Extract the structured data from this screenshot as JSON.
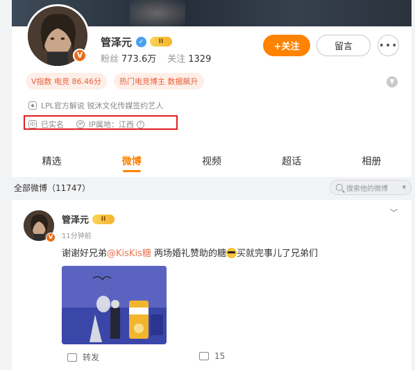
{
  "profile": {
    "name": "管泽元",
    "level_badge": "II",
    "verified_badge": "V",
    "fans_label": "粉丝",
    "fans_count": "773.6万",
    "following_label": "关注",
    "following_count": "1329",
    "follow_button": "+关注",
    "message_button": "留言",
    "more_button": "•••",
    "tags": [
      "V指数 电竞 86.46分",
      "热门电竞博主 数据飙升"
    ],
    "verification_text": "LPL官方解说 锐沐文化传媒签约艺人",
    "realname_text": "已实名",
    "ip_text": "IP属地：江西",
    "ip_help": "?"
  },
  "tabs": [
    "精选",
    "微博",
    "视频",
    "超话",
    "相册"
  ],
  "active_tab": "微博",
  "feed": {
    "all_label": "全部微博（11747）",
    "search_placeholder": "搜索他的微博"
  },
  "post": {
    "author": "管泽元",
    "level_badge": "II",
    "verified_badge": "V",
    "time": "11分钟前",
    "text_prefix": "谢谢好兄弟",
    "mention": "@KisKis糖",
    "text_middle": " 两场婚礼赞助的糖",
    "text_suffix": "买就完事儿了兄弟们",
    "repost_label": "转发",
    "comment_count": "15"
  },
  "colors": {
    "accent": "#ff8200",
    "tag_bg": "#fdeee8",
    "tag_text": "#e8623b",
    "mention": "#eb7350",
    "highlight_box": "#e02020"
  },
  "icons": [
    "verified-icon",
    "shield-icon",
    "id-card-icon",
    "ip-icon",
    "help-icon",
    "search-icon",
    "chevron-down-icon",
    "repost-icon",
    "comment-icon",
    "sunglasses-emoji-icon"
  ]
}
